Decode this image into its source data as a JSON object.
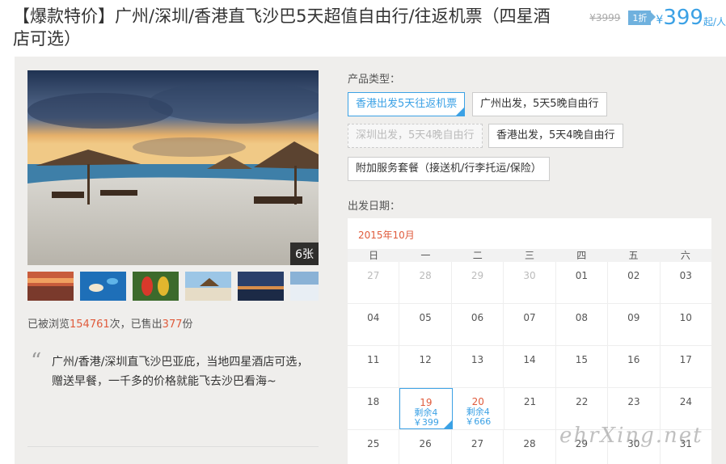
{
  "header": {
    "title": "【爆款特价】广州/深圳/香港直飞沙巴5天超值自由行/往返机票（四星酒店可选）",
    "old_price": "¥3999",
    "discount": "1折",
    "currency": "¥",
    "price": "399",
    "unit": "起/人"
  },
  "gallery": {
    "count_label": "6张",
    "thumbs": [
      "sunset-beach",
      "snorkel-reef",
      "parrots",
      "island-hut",
      "sunset-sea",
      "ocean-view"
    ]
  },
  "stats": {
    "prefix": "已被浏览",
    "views": "154761",
    "mid": "次，已售出",
    "sold": "377",
    "suffix": "份"
  },
  "quote": {
    "mark": "“",
    "text": "广州/香港/深圳直飞沙巴亚庇，当地四星酒店可选，赠送早餐，一千多的价格就能飞去沙巴看海~"
  },
  "product": {
    "label": "产品类型：",
    "options": [
      {
        "label": "香港出发5天往返机票",
        "state": "selected"
      },
      {
        "label": "广州出发，5天5晚自由行",
        "state": "normal"
      },
      {
        "label": "深圳出发，5天4晚自由行",
        "state": "disabled"
      },
      {
        "label": "香港出发，5天4晚自由行",
        "state": "normal"
      },
      {
        "label": "附加服务套餐（接送机/行李托运/保险）",
        "state": "normal"
      }
    ]
  },
  "departure": {
    "label": "出发日期：",
    "month": "2015年10月",
    "weekdays": [
      "日",
      "一",
      "二",
      "三",
      "四",
      "五",
      "六"
    ],
    "weeks": [
      [
        {
          "d": "27",
          "m": true
        },
        {
          "d": "28",
          "m": true
        },
        {
          "d": "29",
          "m": true
        },
        {
          "d": "30",
          "m": true
        },
        {
          "d": "01"
        },
        {
          "d": "02"
        },
        {
          "d": "03"
        }
      ],
      [
        {
          "d": "04"
        },
        {
          "d": "05"
        },
        {
          "d": "06"
        },
        {
          "d": "07"
        },
        {
          "d": "08"
        },
        {
          "d": "09"
        },
        {
          "d": "10"
        }
      ],
      [
        {
          "d": "11"
        },
        {
          "d": "12"
        },
        {
          "d": "13"
        },
        {
          "d": "14"
        },
        {
          "d": "15"
        },
        {
          "d": "16"
        },
        {
          "d": "17"
        }
      ],
      [
        {
          "d": "18"
        },
        {
          "d": "19",
          "s": "剩余4",
          "p": "￥399",
          "picked": true
        },
        {
          "d": "20",
          "s": "剩余4",
          "p": "￥666"
        },
        {
          "d": "21"
        },
        {
          "d": "22"
        },
        {
          "d": "23"
        },
        {
          "d": "24"
        }
      ],
      [
        {
          "d": "25"
        },
        {
          "d": "26"
        },
        {
          "d": "27"
        },
        {
          "d": "28"
        },
        {
          "d": "29"
        },
        {
          "d": "30"
        },
        {
          "d": "31"
        }
      ]
    ]
  },
  "watermark": "ehrXing.net",
  "colors": {
    "accent": "#3ba1e5",
    "highlight": "#e05b3c",
    "panel": "#efeeec"
  }
}
